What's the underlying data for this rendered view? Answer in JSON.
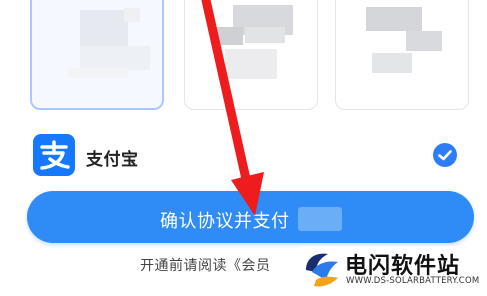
{
  "colors": {
    "accent": "#2f8bf5",
    "alipay": "#1677ff",
    "arrow": "#ee1c1c"
  },
  "payment": {
    "method_label": "支付宝",
    "method_icon": "alipay-icon",
    "checked": true
  },
  "confirm": {
    "label": "确认协议并支付"
  },
  "agreement": {
    "text": "开通前请阅读《会员"
  },
  "watermark": {
    "title": "电闪软件站",
    "url": "WWW.DS-SOLARBATTERY.COM"
  }
}
